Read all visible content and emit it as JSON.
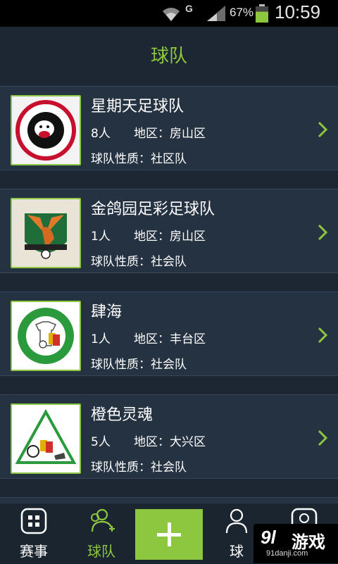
{
  "status_bar": {
    "network": "G",
    "battery_percent": "67%",
    "battery_level": 0.67,
    "time": "10:59"
  },
  "header": {
    "title": "球队"
  },
  "teams": [
    {
      "name": "星期天足球队",
      "members": "8人",
      "region": "地区：房山区",
      "type": "球队性质：社区队",
      "logo_icon": "barnsley-fc-crest-icon"
    },
    {
      "name": "金鸽园足彩足球队",
      "members": "1人",
      "region": "地区：房山区",
      "type": "球队性质：社会队",
      "logo_icon": "eagle-crest-icon"
    },
    {
      "name": "肆海",
      "members": "1人",
      "region": "地区：丰台区",
      "type": "球队性质：社会队",
      "logo_icon": "soccer-club-badge-icon"
    },
    {
      "name": "橙色灵魂",
      "members": "5人",
      "region": "地区：大兴区",
      "type": "球队性质：社会队",
      "logo_icon": "club-soccer-triangle-icon"
    }
  ],
  "bottom_nav": {
    "items": [
      {
        "label": "赛事",
        "icon": "grid-icon"
      },
      {
        "label": "球队",
        "icon": "team-add-icon",
        "active": true
      },
      {
        "label": "+",
        "icon": "plus-icon"
      },
      {
        "label": "球",
        "icon": "person-icon"
      },
      {
        "label": "",
        "icon": "profile-icon"
      }
    ]
  },
  "watermark": {
    "logo": "9l",
    "text": "游戏",
    "url": "91danji.com"
  },
  "colors": {
    "accent": "#8dc63f",
    "background": "#1d2733",
    "card": "#253242"
  }
}
